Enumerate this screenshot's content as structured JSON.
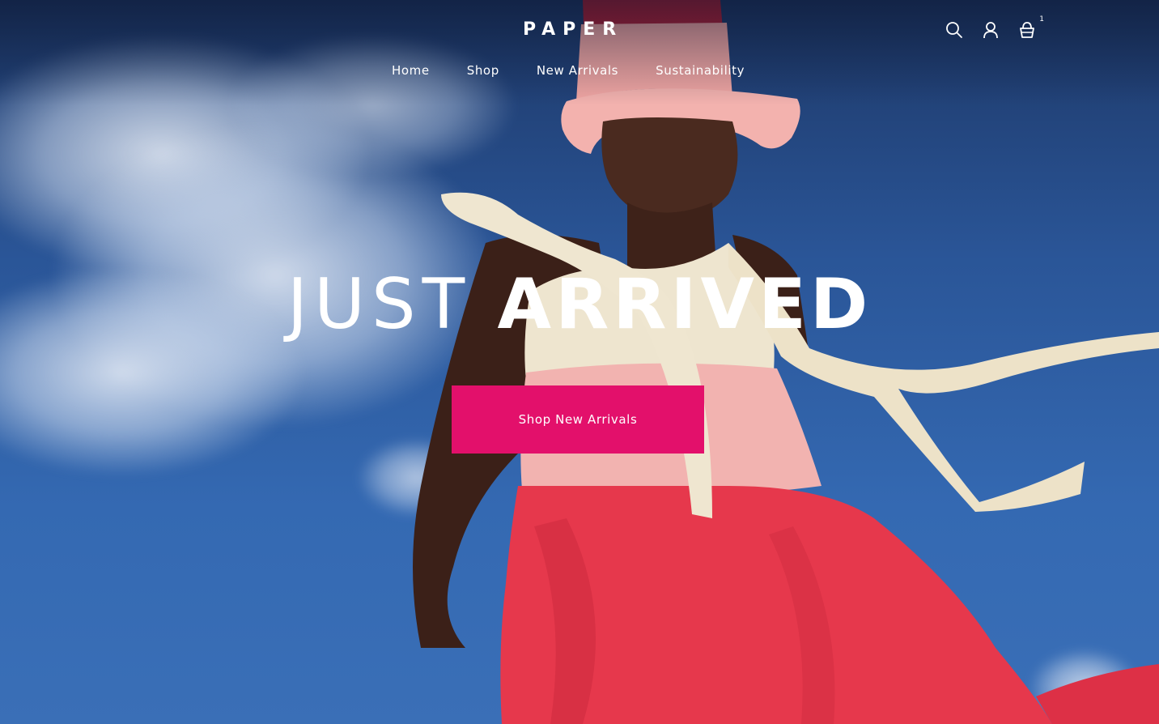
{
  "header": {
    "logo": "PAPER",
    "cart_count": "1",
    "icons": [
      "search-icon",
      "account-icon",
      "basket-icon"
    ]
  },
  "nav": {
    "items": [
      {
        "label": "Home"
      },
      {
        "label": "Shop"
      },
      {
        "label": "New Arrivals"
      },
      {
        "label": "Sustainability"
      }
    ]
  },
  "hero": {
    "headline_light": "JUST",
    "headline_bold": "ARRIVED",
    "cta_label": "Shop New Arrivals"
  },
  "colors": {
    "accent": "#e3106b",
    "sky": "#2f5fa8",
    "dress_red": "#e8394e",
    "dress_pink": "#f3b5b5",
    "ribbon": "#efe6d0",
    "hat_pink": "#f0a3a3"
  }
}
